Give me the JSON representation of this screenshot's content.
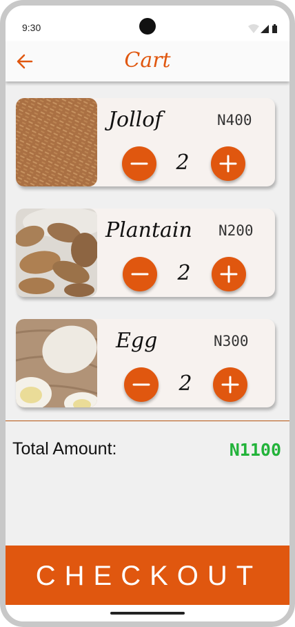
{
  "status_bar": {
    "time": "9:30"
  },
  "header": {
    "title": "Cart"
  },
  "colors": {
    "accent": "#e0570f",
    "total": "#22b33a",
    "card_bg": "#f7f2ef"
  },
  "items": [
    {
      "name": "Jollof",
      "price": "N400",
      "quantity": "2"
    },
    {
      "name": "Plantain",
      "price": "N200",
      "quantity": "2"
    },
    {
      "name": "Egg",
      "price": "N300",
      "quantity": "2"
    }
  ],
  "total": {
    "label": "Total Amount:",
    "value": "N1100"
  },
  "checkout_label": "CHECKOUT",
  "icons": {
    "back": "arrow-left-icon",
    "minus": "minus-icon",
    "plus": "plus-icon"
  }
}
